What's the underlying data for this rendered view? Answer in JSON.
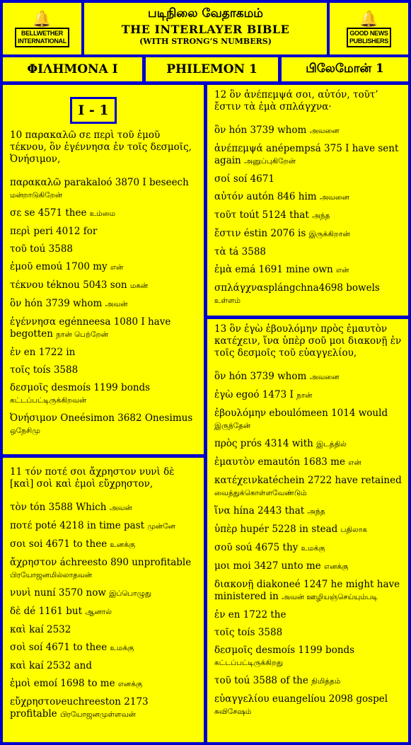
{
  "header": {
    "left_logo": {
      "line1": "BELLWETHER",
      "line2": "INTERNATIONAL"
    },
    "right_logo": {
      "line1": "GOOD NEWS",
      "line2": "PUBLISHERS"
    },
    "tamil_title": "படிநிலை வேதாகமம்",
    "title": "THE  INTERLAYER BIBLE",
    "subtitle": "(WITH STRONG’S NUMBERS)"
  },
  "book_bar": {
    "greek": "ΦΙΛΗΜΟΝΑ  I",
    "english": "PHILEMON   1",
    "tamil": "பிலேமோன்  1"
  },
  "chapter_label": "I - 1",
  "colors": {
    "background": "#0000cc",
    "panel": "#ffff00"
  },
  "verses": [
    {
      "heading": "10   παρακαλῶ σε περὶ τοῦ ἐμοῦ τέκνου, ὃν ἐγέννησα ἐν τοῖς δεσμοῖς, Ὀνήσιμον,",
      "entries": [
        {
          "greek": "παρακαλῶ",
          "rest": "  parakaloó  3870  I beseech",
          "tamil": "மன்றாடுகிறேன்"
        },
        {
          "greek": "σε",
          "rest": "  se 4571   thee",
          "tamil": "உம்மை"
        },
        {
          "greek": "περὶ",
          "rest": "  peri   4012  for",
          "tamil": ""
        },
        {
          "greek": "τοῦ",
          "rest": "  toú 3588",
          "tamil": ""
        },
        {
          "greek": "ἐμοῦ",
          "rest": "  emoú 1700  my",
          "tamil": "என்"
        },
        {
          "greek": "τέκνου",
          "rest": "  téknou 5043  son",
          "tamil": "மகன்"
        },
        {
          "greek": "ὃν",
          "rest": "  hón  3739   whom",
          "tamil": "அவன்"
        },
        {
          "greek": "ἐγέννησα",
          "rest": "   egénneesa    1080    I have begotten",
          "tamil": "நான் பெற்றேன்"
        },
        {
          "greek": "ἐν",
          "rest": "  en 1722  in",
          "tamil": ""
        },
        {
          "greek": "τοῖς",
          "rest": "  toís   3588",
          "tamil": ""
        },
        {
          "greek": "δεσμοῖς",
          "rest": "   desmoís     1199     bonds",
          "tamil": "கட்டப்பட்டிருக்கிறவன்"
        },
        {
          "greek": "Ὀνήσιμον",
          "rest": " Oneésimon 3682   Onesimus",
          "tamil": "ஒநேசிமு"
        }
      ]
    },
    {
      "heading": "11  τόν ποτέ σοι ἄχρηστον νυνὶ δὲ [καὶ] σοὶ καὶ ἐμοὶ εὔχρηστον,",
      "entries": [
        {
          "greek": "τὸν",
          "rest": "  tón 3588  Which",
          "tamil": "அவன்"
        },
        {
          "greek": "ποτέ",
          "rest": "  poté   4218  in time past",
          "tamil": "முன்னே"
        },
        {
          "greek": "σοι",
          "rest": "  soi 4671  to thee",
          "tamil": "உனக்கு"
        },
        {
          "greek": "ἄχρηστον",
          "rest": "  áchreesto  890  unprofitable",
          "tamil": "பிரயோஜனமில்லாதவன்"
        },
        {
          "greek": "νυνὶ",
          "rest": "  nuní  3570   now",
          "tamil": "இப்பொழுது"
        },
        {
          "greek": "δὲ",
          "rest": "  dé  1161  but",
          "tamil": "ஆனால்"
        },
        {
          "greek": "καὶ",
          "rest": "  kaí  2532",
          "tamil": ""
        },
        {
          "greek": "σοὶ",
          "rest": "   soí   4671  to thee",
          "tamil": "உமக்கு"
        },
        {
          "greek": "καὶ",
          "rest": "  kaí  2532  and",
          "tamil": ""
        },
        {
          "greek": "ἐμοὶ",
          "rest": "  emoí   1698   to me",
          "tamil": "எனக்கு"
        },
        {
          "greek": "εὔχρηστον",
          "rest": "euchreeston 2173  profitable",
          "tamil": "பிரயோஜனமுள்ளவன்"
        }
      ]
    },
    {
      "heading": "12   ὃν ἀνέπεμψά σοι, αὐτόν, τοῦτ’ ἔστιν τὰ ἐμὰ σπλάγχνα·",
      "entries": [
        {
          "greek": "ὃν",
          "rest": "  hón  3739   whom",
          "tamil": "அவனை"
        },
        {
          "greek": "ἀνέπεμψά",
          "rest": "   anépempsá   375  I have sent again",
          "tamil": "அனுப்புகிறேன்"
        },
        {
          "greek": "σοί",
          "rest": "   soí   4671",
          "tamil": ""
        },
        {
          "greek": "αὐτόν",
          "rest": "  autón  846  him",
          "tamil": "அவனை"
        },
        {
          "greek": "τοῦτ",
          "rest": "  toút   5124  that",
          "tamil": "அந்த"
        },
        {
          "greek": "ἔστιν",
          "rest": "   éstin  2076  is",
          "tamil": "இருக்கிறான்"
        },
        {
          "greek": "τὰ",
          "rest": "  tá  3588",
          "tamil": ""
        },
        {
          "greek": "ἐμὰ",
          "rest": "  emá  1691  mine own",
          "tamil": "என்"
        },
        {
          "greek": "σπλάγχνα",
          "rest": "splángchna4698 bowels",
          "tamil": "உள்ளம்"
        }
      ]
    },
    {
      "heading": "13  ὃν ἐγὼ ἐβουλόμην πρὸς ἐμαυτὸν κατέχειν, ἵνα ὑπὲρ σοῦ μοι διακονῇ ἐν τοῖς δεσμοῖς   τοῦ εὐαγγελίου,",
      "entries": [
        {
          "greek": "ὃν",
          "rest": "  hón  3739   whom",
          "tamil": "அவனை"
        },
        {
          "greek": "ἐγὼ",
          "rest": "  egoó  1473  I",
          "tamil": "நான்"
        },
        {
          "greek": "ἐβουλόμην",
          "rest": "   eboulómeen   1014   would",
          "tamil": "இருந்தேன்"
        },
        {
          "greek": "πρὸς",
          "rest": "  prós  4314  with",
          "tamil": "இடத்தில்"
        },
        {
          "greek": "ἐμαυτὸν",
          "rest": "  emautón  1683  me",
          "tamil": "என்"
        },
        {
          "greek": "κατέχειν",
          "rest": "katéchein  2722  have retained",
          "tamil": "வைத்துக்கொள்ளவேண்டும்"
        },
        {
          "greek": "ἵνα",
          "rest": "  hína  2443  that",
          "tamil": "அந்த"
        },
        {
          "greek": "ὑπὲρ",
          "rest": "  hupér  5228  in stead",
          "tamil": "பதிலாக"
        },
        {
          "greek": "σοῦ",
          "rest": "  soú    4675  thy",
          "tamil": "உமக்கு"
        },
        {
          "greek": "μοι",
          "rest": "  moi  3427  unto me",
          "tamil": "எனக்கு"
        },
        {
          "greek": "διακονῇ",
          "rest": "    diakoneé    1247    he might have  ministered  in",
          "tamil": "அவன் ஊழியஞ்செய்யும்படி"
        },
        {
          "greek": "ἐν",
          "rest": "  en  1722  the",
          "tamil": ""
        },
        {
          "greek": "τοῖς",
          "rest": "  toís  3588",
          "tamil": ""
        },
        {
          "greek": "δεσμοῖς",
          "rest": "    desmoís     1199     bonds",
          "tamil": "கட்டப்பட்டிருக்கிறது"
        },
        {
          "greek": "τοῦ",
          "rest": "  toú    3588  of the",
          "tamil": "நிமித்தம்"
        },
        {
          "greek": "εὐαγγελίου",
          "rest": "  euangelíou   2098   gospel",
          "tamil": "சுவிசேஷம்"
        }
      ]
    }
  ]
}
